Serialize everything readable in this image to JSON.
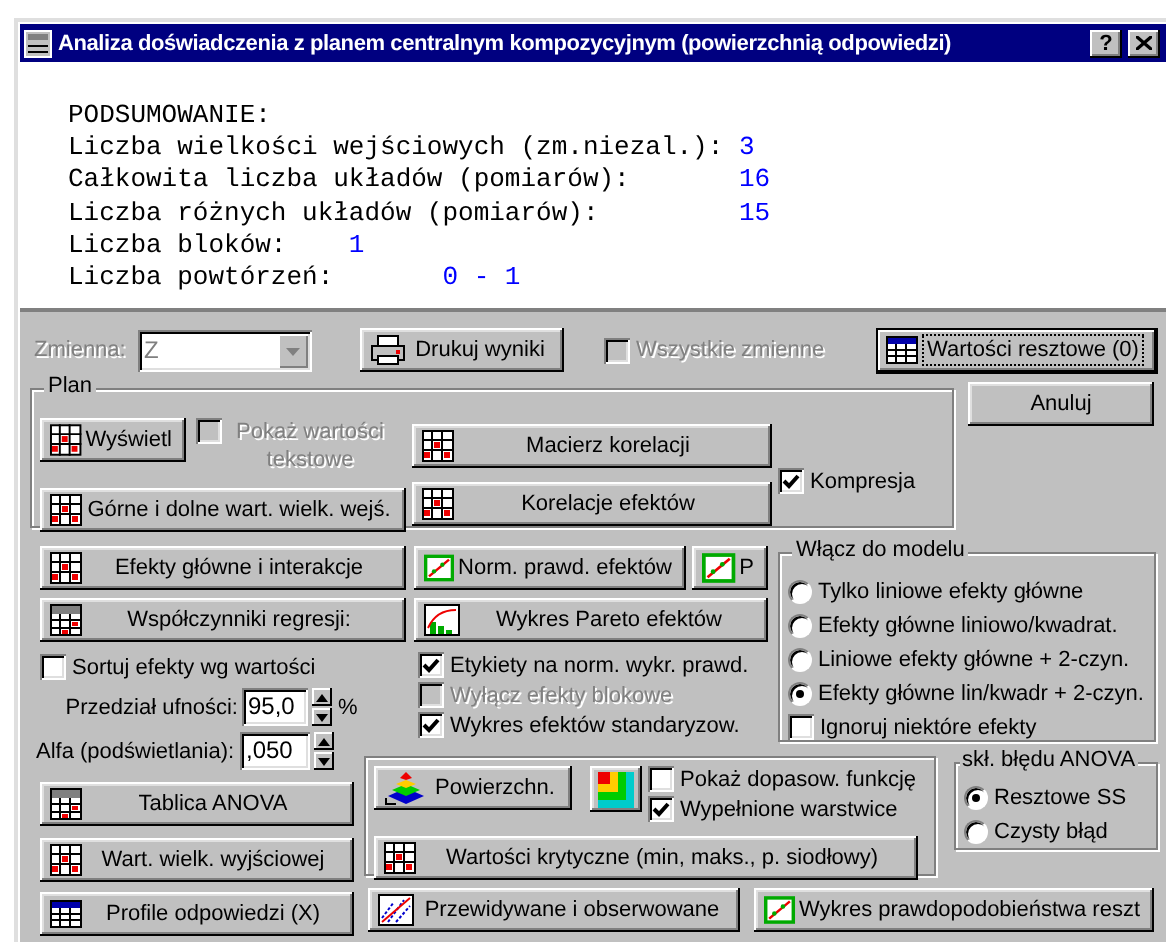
{
  "window": {
    "title": "Analiza doświadczenia z planem centralnym kompozycyjnym (powierzchnią odpowiedzi)",
    "help_button": "?"
  },
  "summary": {
    "heading": "PODSUMOWANIE:",
    "lines": [
      {
        "label": "Liczba wielkości wejściowych (zm.niezal.):",
        "value": "3"
      },
      {
        "label": "Całkowita liczba układów (pomiarów):",
        "value": "16"
      },
      {
        "label": "Liczba różnych układów (pomiarów):",
        "value": "15"
      },
      {
        "label": "Liczba bloków:",
        "value": "1"
      },
      {
        "label": "Liczba powtórzeń:",
        "value": "0 - 1"
      }
    ]
  },
  "toolbar": {
    "variable": {
      "label": "Zmienna:",
      "value": "Z",
      "disabled": true
    },
    "print_button": "Drukuj wyniki",
    "all_variables": {
      "label": "Wszystkie zmienne",
      "checked": false,
      "disabled": true
    },
    "residuals_button": {
      "label": "Wartości resztowe (0)",
      "focused": true
    }
  },
  "cancel_button": "Anuluj",
  "plan": {
    "title": "Plan",
    "display_button": "Wyświetl",
    "show_text_values": {
      "label": "Pokaż wartości tekstowe",
      "checked": false,
      "disabled": true
    },
    "correlation_matrix_button": "Macierz korelacji",
    "high_low_button": "Górne i dolne wart. wielk. wejś.",
    "effect_correlations_button": "Korelacje efektów",
    "compression": {
      "label": "Kompresja",
      "checked": true,
      "disabled": false
    }
  },
  "effects": {
    "main_effects_button": "Efekty główne i interakcje",
    "regression_button": "Współczynniki regresji:",
    "sort_effects": {
      "label": "Sortuj efekty wg wartości",
      "checked": false,
      "disabled": false
    },
    "confidence": {
      "label": "Przedział ufności:",
      "value": "95,0",
      "unit": "%"
    },
    "alpha": {
      "label": "Alfa (podświetlania):",
      "value": ",050"
    },
    "anova_button": "Tablica ANOVA",
    "output_values_button": "Wart. wielk. wyjściowej",
    "profiles_button": "Profile odpowiedzi (X)"
  },
  "plots": {
    "normal_plot_button": "Norm. prawd. efektów",
    "p_button": "P",
    "pareto_button": "Wykres Pareto efektów",
    "options": [
      {
        "label": "Etykiety na norm. wykr. prawd.",
        "checked": true,
        "disabled": false
      },
      {
        "label": "Wyłącz efekty blokowe",
        "checked": false,
        "disabled": true
      },
      {
        "label": "Wykres efektów standaryzow.",
        "checked": true,
        "disabled": false
      }
    ]
  },
  "model": {
    "title": "Włącz do modelu",
    "options": [
      {
        "label": "Tylko liniowe efekty główne",
        "selected": false
      },
      {
        "label": "Efekty główne liniowo/kwadrat.",
        "selected": false
      },
      {
        "label": "Liniowe efekty główne + 2-czyn.",
        "selected": false
      },
      {
        "label": "Efekty główne lin/kwadr + 2-czyn.",
        "selected": true
      }
    ],
    "ignore_effects": {
      "label": "Ignoruj niektóre efekty",
      "checked": false,
      "disabled": false
    }
  },
  "surface": {
    "surface_button": "Powierzchn.",
    "show_fit": {
      "label": "Pokaż dopasow. funkcję",
      "checked": false,
      "disabled": false
    },
    "filled_contours": {
      "label": "Wypełnione warstwice",
      "checked": true,
      "disabled": false
    },
    "critical_values_button": "Wartości krytyczne (min, maks., p. siodłowy)"
  },
  "anova_error": {
    "title": "skł. błędu ANOVA",
    "options": [
      {
        "label": "Resztowe SS",
        "selected": true
      },
      {
        "label": "Czysty błąd",
        "selected": false
      }
    ]
  },
  "bottom_buttons": {
    "observed_button": "Przewidywane i obserwowane",
    "residual_probability_button": "Wykres prawdopodobieństwa reszt"
  }
}
